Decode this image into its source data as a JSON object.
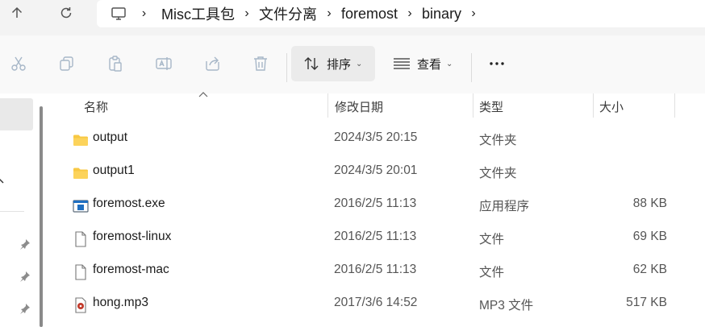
{
  "nav": {
    "up_icon": "arrow-up-icon",
    "refresh_icon": "refresh-icon"
  },
  "breadcrumb": {
    "root_icon": "computer-icon",
    "items": [
      "Misc工具包",
      "文件分离",
      "foremost",
      "binary"
    ]
  },
  "toolbar": {
    "icons": [
      "cut-icon",
      "copy-icon",
      "paste-icon",
      "rename-icon",
      "share-icon",
      "delete-icon"
    ],
    "sort_label": "排序",
    "view_label": "查看",
    "more_icon": "more-icon"
  },
  "columns": {
    "name": "名称",
    "date": "修改日期",
    "type": "类型",
    "size": "大小"
  },
  "files": [
    {
      "name": "output",
      "date": "2024/3/5 20:15",
      "type": "文件夹",
      "size": "",
      "icon": "folder-icon"
    },
    {
      "name": "output1",
      "date": "2024/3/5 20:01",
      "type": "文件夹",
      "size": "",
      "icon": "folder-icon"
    },
    {
      "name": "foremost.exe",
      "date": "2016/2/5 11:13",
      "type": "应用程序",
      "size": "88 KB",
      "icon": "exe-icon"
    },
    {
      "name": "foremost-linux",
      "date": "2016/2/5 11:13",
      "type": "文件",
      "size": "69 KB",
      "icon": "file-icon"
    },
    {
      "name": "foremost-mac",
      "date": "2016/2/5 11:13",
      "type": "文件",
      "size": "62 KB",
      "icon": "file-icon"
    },
    {
      "name": "hong.mp3",
      "date": "2017/3/6 14:52",
      "type": "MP3 文件",
      "size": "517 KB",
      "icon": "audio-file-icon"
    }
  ],
  "colors": {
    "folder": "#f8c843",
    "accent": "#1f6fc1"
  }
}
